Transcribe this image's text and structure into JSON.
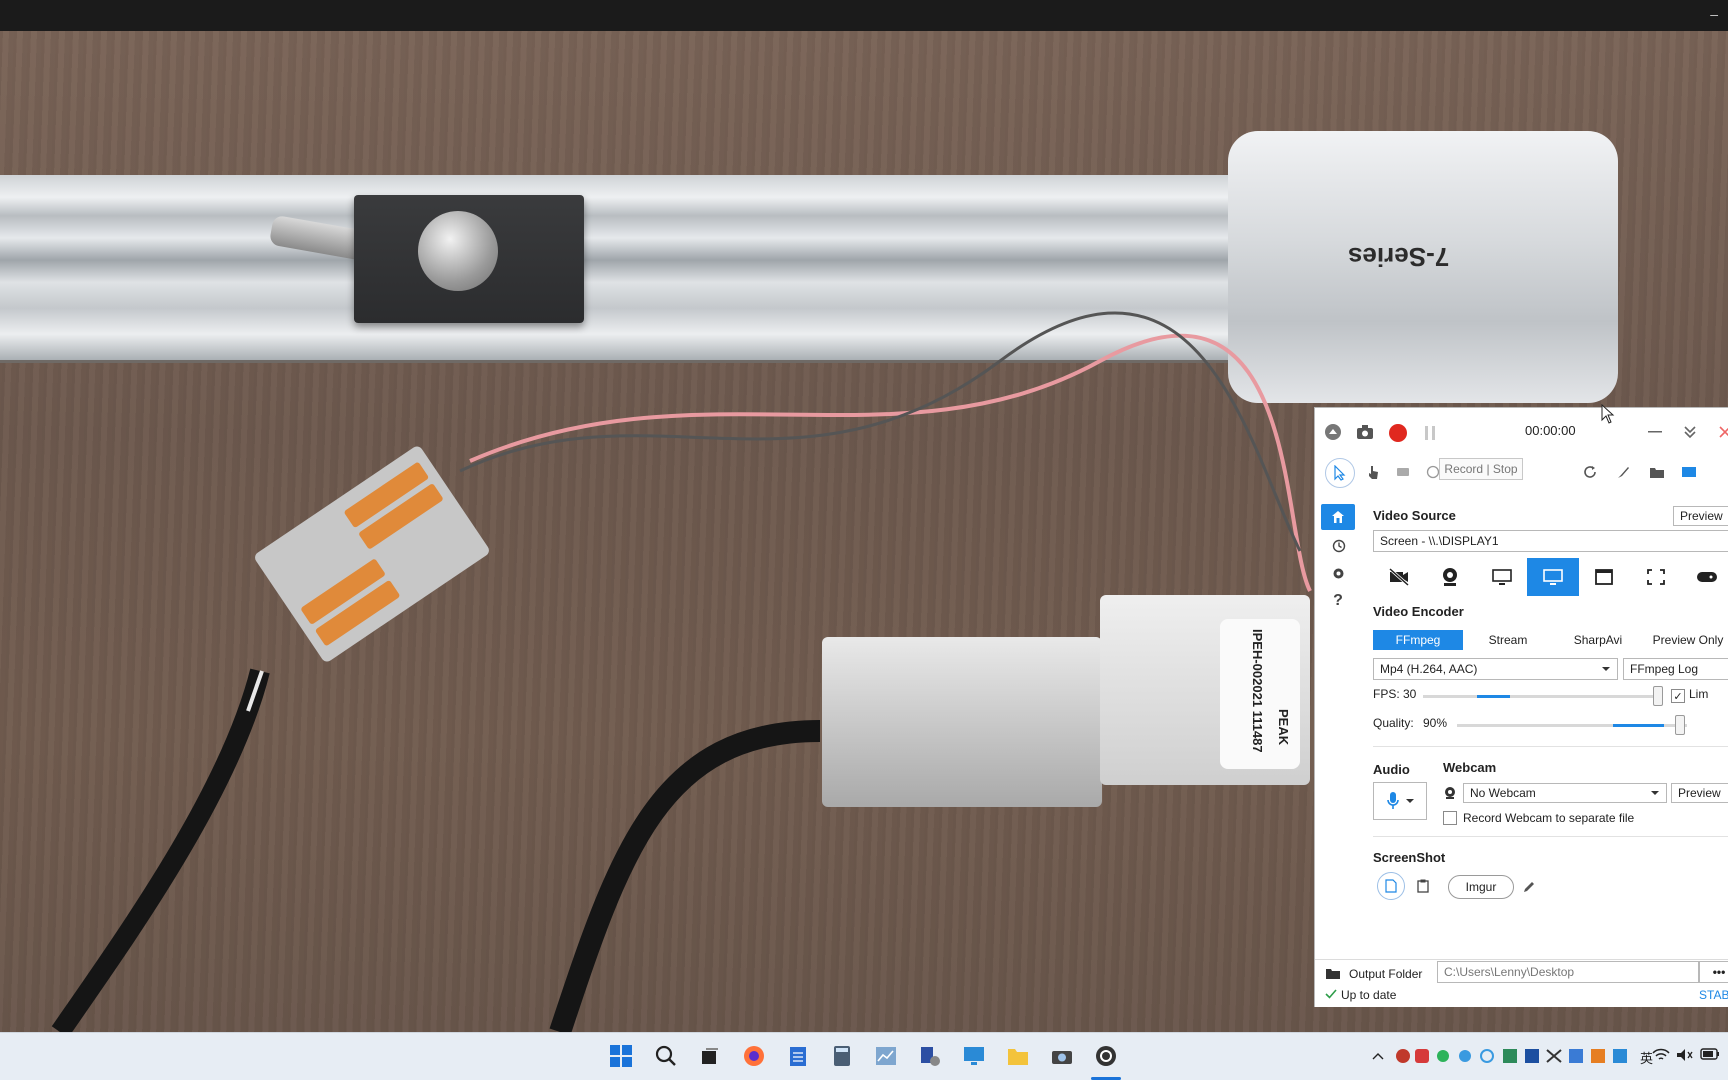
{
  "window": {
    "minimize_glyph": "–"
  },
  "recorder": {
    "timer": "00:00:00",
    "tooltip": "Record | Stop",
    "video_source": {
      "title": "Video Source",
      "preview_label": "Preview",
      "selected": "Screen - \\\\.\\DISPLAY1",
      "sources": [
        "no-video-icon",
        "webcam-icon",
        "screen-icon",
        "display-icon",
        "window-icon",
        "region-icon",
        "gamepad-icon"
      ]
    },
    "video_encoder": {
      "title": "Video Encoder",
      "tabs": [
        "FFmpeg",
        "Stream",
        "SharpAvi",
        "Preview Only"
      ],
      "format": "Mp4 (H.264, AAC)",
      "log_button": "FFmpeg Log",
      "fps_label": "FPS:",
      "fps_value": "30",
      "fps_level": 0.37,
      "limit_label": "Lim",
      "quality_label": "Quality:",
      "quality_value": "90%",
      "quality_level": 0.9
    },
    "audio": {
      "title": "Audio"
    },
    "webcam": {
      "title": "Webcam",
      "selected": "No Webcam",
      "preview_label": "Preview",
      "separate_file_label": "Record Webcam to separate file"
    },
    "screenshot": {
      "title": "ScreenShot",
      "imgur_label": "Imgur"
    },
    "output": {
      "label": "Output Folder",
      "path": "C:\\Users\\Lenny\\Desktop"
    },
    "status": {
      "text": "Up to date",
      "channel": "STAB"
    }
  },
  "taskbar": {
    "tray_lang": "英"
  },
  "photo": {
    "sensor_text": "7-Series",
    "label_text": "IPEH-002021 111487",
    "brand_text": "PEAK"
  },
  "colors": {
    "accent": "#1e88e5",
    "record": "#e0281f"
  }
}
